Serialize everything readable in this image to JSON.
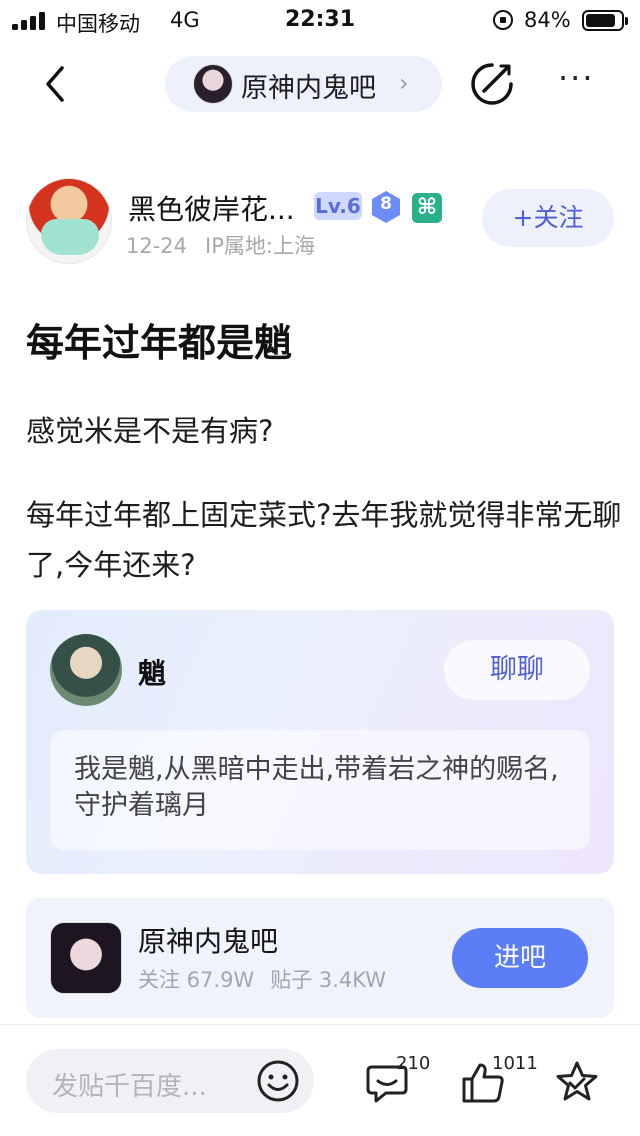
{
  "status_bar": {
    "carrier": "中国移动",
    "network": "4G",
    "time": "22:31",
    "battery_percent": "84%",
    "battery_level": 0.84
  },
  "nav": {
    "back_icon": "chevron-left-icon",
    "forum_name": "原神内鬼吧",
    "forum_chevron": "›",
    "edit_icon": "share-edit-icon",
    "more_label": "···"
  },
  "author": {
    "name": "黑色彼岸花...",
    "level": "Lv.6",
    "gem_number": "8",
    "badge_glyph": "⌘",
    "date": "12-24",
    "ip_location": "IP属地:上海",
    "follow_label": "+关注"
  },
  "post": {
    "title": "每年过年都是魈",
    "paragraphs": [
      "感觉米是不是有病?",
      "每年过年都上固定菜式?去年我就觉得非常无聊了,今年还来?"
    ]
  },
  "ai_card": {
    "name": "魈",
    "chat_label": "聊聊",
    "intro": "我是魈,从黑暗中走出,带着岩之神的赐名,守护着璃月"
  },
  "forum_card": {
    "name": "原神内鬼吧",
    "followers": "关注 67.9W",
    "posts": "贴子 3.4KW",
    "enter_label": "进吧"
  },
  "bottom_bar": {
    "reply_placeholder": "发贴千百度...",
    "comment_count": "210",
    "like_count": "1011",
    "accent_color": "#5b7df6"
  }
}
